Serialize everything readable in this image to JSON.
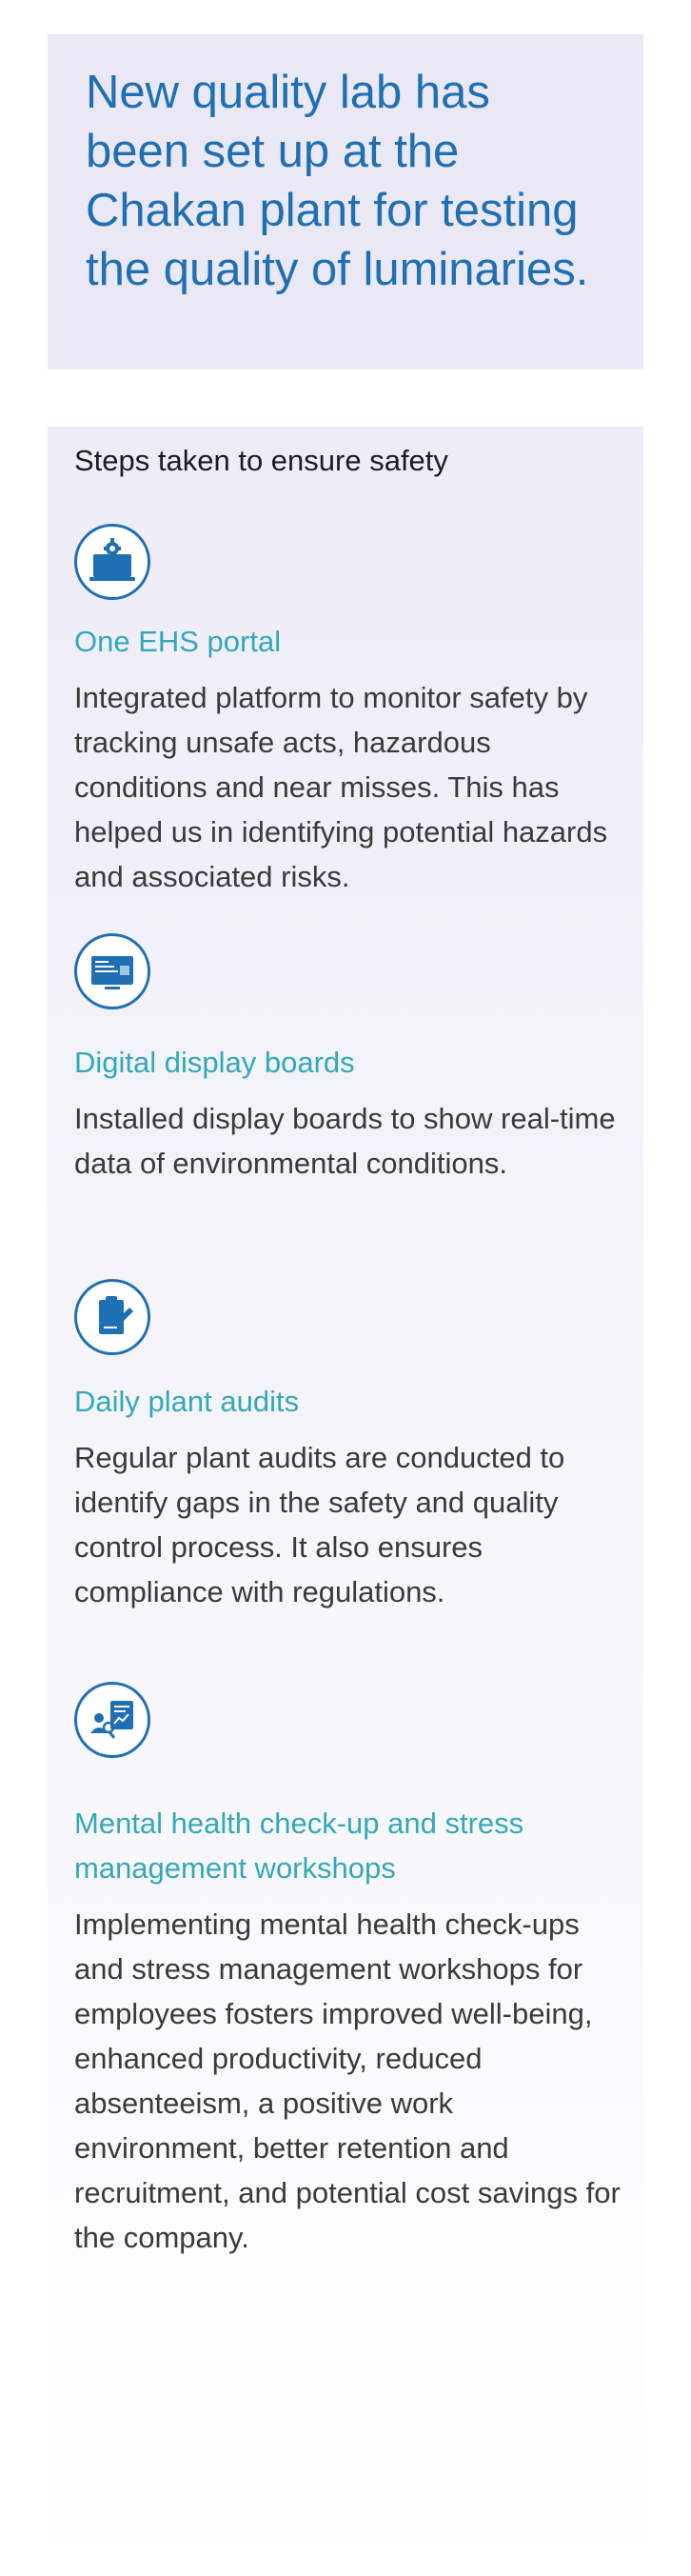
{
  "callout": {
    "text": "New quality lab has been set up at the Chakan plant for testing the quality of luminaries."
  },
  "panel": {
    "heading": "Steps taken to ensure safety",
    "steps": [
      {
        "icon": "ehs-portal-icon",
        "title": "One EHS portal",
        "description": "Integrated platform to monitor safety by tracking unsafe acts, hazardous conditions and near misses. This has helped us in identifying potential hazards and associated risks."
      },
      {
        "icon": "display-board-icon",
        "title": "Digital display boards",
        "description": "Installed display boards to show real-time data of environmental conditions."
      },
      {
        "icon": "clipboard-audit-icon",
        "title": "Daily plant audits",
        "description": "Regular plant audits are conducted to identify gaps in the safety and quality control process. It also ensures compliance with regulations."
      },
      {
        "icon": "mental-health-icon",
        "title": "Mental health check-up and stress management workshops",
        "description": "Implementing mental health check-ups and stress management workshops for employees fosters improved well-being, enhanced productivity, reduced absenteeism, a positive work environment, better retention and recruitment, and potential cost savings for the company."
      }
    ]
  },
  "colors": {
    "accent_blue": "#1f6fb5",
    "title_teal": "#33a8b8",
    "callout_bg": "#e9e8f4",
    "body_text": "#3a3a3a"
  }
}
